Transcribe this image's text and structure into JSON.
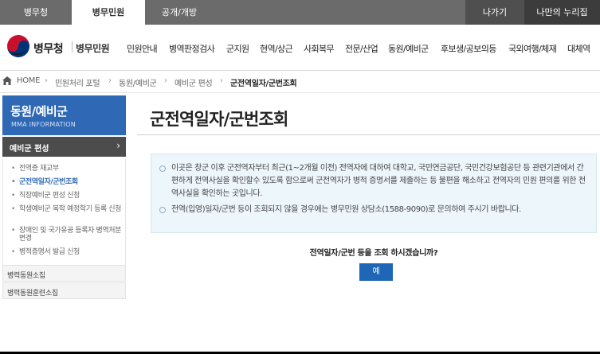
{
  "top_tabs": [
    {
      "label": "병무청"
    },
    {
      "label": "병무민원"
    },
    {
      "label": "공개/개방"
    }
  ],
  "utility_links": [
    {
      "label": "나가기"
    },
    {
      "label": "나만의 누리집"
    }
  ],
  "brand": {
    "name": "병무청",
    "sub": "병무민원"
  },
  "gnb": [
    {
      "label": "민원안내"
    },
    {
      "label": "병역판정검사"
    },
    {
      "label": "군지원"
    },
    {
      "label": "현역/상근"
    },
    {
      "label": "사회복무"
    },
    {
      "label": "전문/산업"
    },
    {
      "label": "동원/예비군"
    },
    {
      "label": "후보생/공보의등"
    },
    {
      "label": "국외여행/체재"
    },
    {
      "label": "대체역"
    }
  ],
  "breadcrumb": [
    {
      "label": "HOME"
    },
    {
      "label": "민원처리 포털"
    },
    {
      "label": "동원/예비군"
    },
    {
      "label": "예비군 편성"
    },
    {
      "label": "군전역일자/군번조회"
    }
  ],
  "sidebar": {
    "title": "동원/예비군",
    "subtitle": "MMA INFORMATION",
    "active_section": "예비군 편성",
    "sub_items": [
      {
        "label": "전역증 재교부"
      },
      {
        "label": "군전역일자/군번조회"
      },
      {
        "label": "직장예비군 편성 신청"
      },
      {
        "label": "학생예비군 복학 예정학기 등록 신청"
      },
      {
        "label": "장애인 및 국가유공 등록자 병역처분변경"
      },
      {
        "label": "병적증명서 발급 신청"
      }
    ],
    "sections": [
      {
        "label": "병력동원소집"
      },
      {
        "label": "병력동원훈련소집"
      }
    ]
  },
  "main": {
    "title": "군전역일자/군번조회",
    "notices": [
      {
        "text": "이곳은 창군 이후 군전역자부터 최근(1~2개월 이전) 전역자에 대하여 대학교, 국민연금공단, 국민건강보험공단 등 관련기관에서 간편하게 전역사실을 확인할수 있도록 함으로써 군전역자가 병적 증명서를 제출하는 등 불편을 해소하고 전역자의 민원 편의를 위한 전역사실을 확인하는 곳입니다."
      },
      {
        "text": "전역(입영)일자/군번 등이 조회되지 않을 경우에는 병무민원 상담소(1588-9090)로 문의하여 주시기 바랍니다."
      }
    ],
    "question": "전역일자/군번 등을 조회 하시겠습니까?",
    "yes_label": "예"
  },
  "colors": {
    "accent": "#2f68b5",
    "button": "#1f66b6",
    "notice_bg": "#edf6fb"
  }
}
